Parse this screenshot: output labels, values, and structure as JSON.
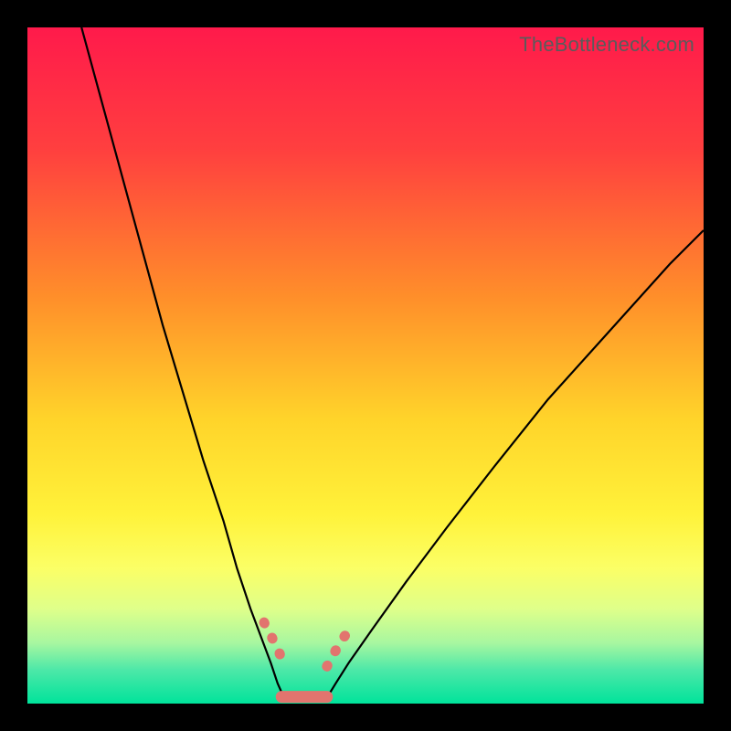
{
  "watermark": "TheBottleneck.com",
  "gradient_stops": [
    {
      "offset": 0,
      "color": "#ff1a4b"
    },
    {
      "offset": 18,
      "color": "#ff3f3f"
    },
    {
      "offset": 40,
      "color": "#ff8f2a"
    },
    {
      "offset": 58,
      "color": "#ffd42a"
    },
    {
      "offset": 72,
      "color": "#fff23a"
    },
    {
      "offset": 80,
      "color": "#fbff66"
    },
    {
      "offset": 86,
      "color": "#dfff8a"
    },
    {
      "offset": 91,
      "color": "#a8f7a0"
    },
    {
      "offset": 95,
      "color": "#4de8a8"
    },
    {
      "offset": 100,
      "color": "#00e39b"
    }
  ],
  "chart_data": {
    "type": "line",
    "title": "",
    "xlabel": "",
    "ylabel": "",
    "xlim": [
      0,
      100
    ],
    "ylim": [
      0,
      100
    ],
    "grid": false,
    "series": [
      {
        "name": "left-branch",
        "stroke": "#000000",
        "stroke_width": 2.2,
        "x": [
          8,
          11,
          14,
          17,
          20,
          23,
          26,
          29,
          31,
          33,
          34.5,
          36,
          37,
          37.8
        ],
        "y": [
          100,
          89,
          78,
          67,
          56,
          46,
          36,
          27,
          20,
          14,
          10,
          6,
          3,
          1.2
        ]
      },
      {
        "name": "right-branch",
        "stroke": "#000000",
        "stroke_width": 2.2,
        "x": [
          44.5,
          45.6,
          47.5,
          51,
          56,
          62,
          69,
          77,
          86,
          95,
          100
        ],
        "y": [
          1.2,
          3,
          6,
          11,
          18,
          26,
          35,
          45,
          55,
          65,
          70
        ]
      },
      {
        "name": "beads-left",
        "stroke": "#e2746e",
        "stroke_width": 11,
        "linecap": "round",
        "x": [
          35.0,
          35.7,
          36.2,
          36.9,
          37.3,
          37.9
        ],
        "y": [
          12.0,
          10.5,
          9.7,
          8.2,
          7.4,
          5.9
        ]
      },
      {
        "name": "beads-right",
        "stroke": "#e2746e",
        "stroke_width": 11,
        "linecap": "round",
        "x": [
          44.3,
          44.9,
          45.5,
          46.2,
          46.8,
          47.6
        ],
        "y": [
          5.5,
          6.8,
          7.7,
          8.9,
          9.8,
          11.0
        ]
      },
      {
        "name": "floor-segment",
        "stroke": "#e2746e",
        "stroke_width": 13,
        "linecap": "round",
        "x": [
          37.6,
          44.3
        ],
        "y": [
          1.0,
          1.0
        ]
      }
    ],
    "notes": "V-shaped bottleneck curve over a vertical red→orange→yellow→green gradient. Minimum sits near x≈41% of the horizontal range at the green floor. Salmon-colored 'beads' highlight the lower ends of both branches and a short floor segment at the trough."
  }
}
